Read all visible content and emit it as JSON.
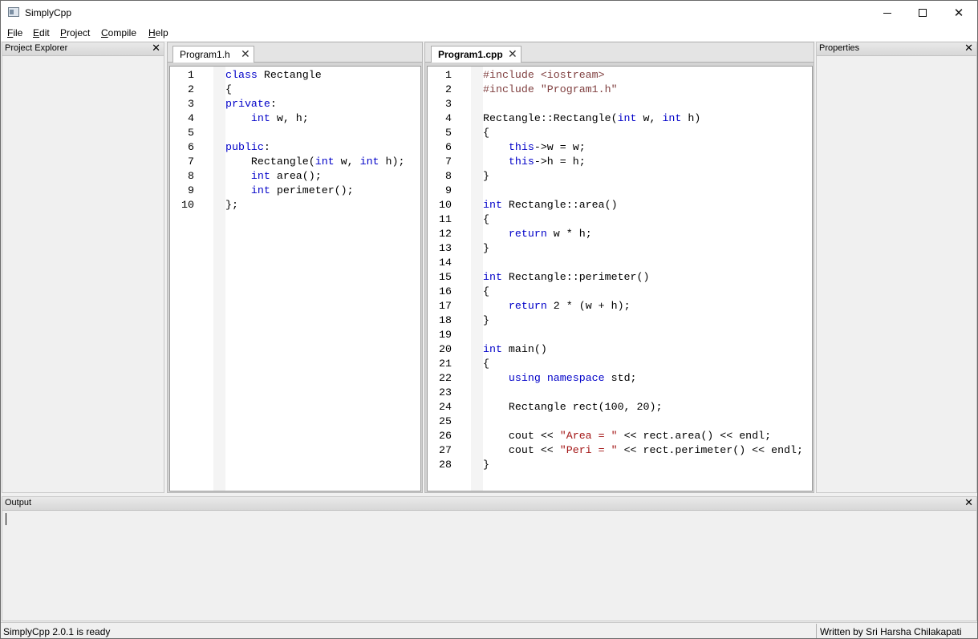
{
  "window": {
    "title": "SimplyCpp",
    "minimize_glyph": "",
    "maximize_glyph": "",
    "close_glyph": "✕"
  },
  "menu": {
    "items": [
      {
        "mnemonic": "F",
        "rest": "ile"
      },
      {
        "mnemonic": "E",
        "rest": "dit"
      },
      {
        "mnemonic": "P",
        "rest": "roject"
      },
      {
        "mnemonic": "C",
        "rest": "ompile"
      },
      {
        "mnemonic": "H",
        "rest": "elp"
      }
    ]
  },
  "panels": {
    "project_explorer": {
      "title": "Project Explorer",
      "close": "✕"
    },
    "properties": {
      "title": "Properties",
      "close": "✕"
    },
    "output": {
      "title": "Output",
      "close": "✕"
    }
  },
  "editors": {
    "left": {
      "tab_label": "Program1.h",
      "tab_close": "✕",
      "lines": [
        [
          {
            "t": "keyword",
            "s": "class"
          },
          {
            "t": "plain",
            "s": " Rectangle"
          }
        ],
        [
          {
            "t": "plain",
            "s": "{"
          }
        ],
        [
          {
            "t": "keyword",
            "s": "private"
          },
          {
            "t": "plain",
            "s": ":"
          }
        ],
        [
          {
            "t": "plain",
            "s": "    "
          },
          {
            "t": "keyword",
            "s": "int"
          },
          {
            "t": "plain",
            "s": " w, h;"
          }
        ],
        [],
        [
          {
            "t": "keyword",
            "s": "public"
          },
          {
            "t": "plain",
            "s": ":"
          }
        ],
        [
          {
            "t": "plain",
            "s": "    Rectangle("
          },
          {
            "t": "keyword",
            "s": "int"
          },
          {
            "t": "plain",
            "s": " w, "
          },
          {
            "t": "keyword",
            "s": "int"
          },
          {
            "t": "plain",
            "s": " h);"
          }
        ],
        [
          {
            "t": "plain",
            "s": "    "
          },
          {
            "t": "keyword",
            "s": "int"
          },
          {
            "t": "plain",
            "s": " area();"
          }
        ],
        [
          {
            "t": "plain",
            "s": "    "
          },
          {
            "t": "keyword",
            "s": "int"
          },
          {
            "t": "plain",
            "s": " perimeter();"
          }
        ],
        [
          {
            "t": "plain",
            "s": "};"
          }
        ]
      ]
    },
    "right": {
      "tab_label": "Program1.cpp",
      "tab_close": "✕",
      "lines": [
        [
          {
            "t": "preproc",
            "s": "#include <iostream>"
          }
        ],
        [
          {
            "t": "preproc",
            "s": "#include \"Program1.h\""
          }
        ],
        [],
        [
          {
            "t": "plain",
            "s": "Rectangle::Rectangle("
          },
          {
            "t": "keyword",
            "s": "int"
          },
          {
            "t": "plain",
            "s": " w, "
          },
          {
            "t": "keyword",
            "s": "int"
          },
          {
            "t": "plain",
            "s": " h)"
          }
        ],
        [
          {
            "t": "plain",
            "s": "{"
          }
        ],
        [
          {
            "t": "plain",
            "s": "    "
          },
          {
            "t": "keyword",
            "s": "this"
          },
          {
            "t": "plain",
            "s": "->w = w;"
          }
        ],
        [
          {
            "t": "plain",
            "s": "    "
          },
          {
            "t": "keyword",
            "s": "this"
          },
          {
            "t": "plain",
            "s": "->h = h;"
          }
        ],
        [
          {
            "t": "plain",
            "s": "}"
          }
        ],
        [],
        [
          {
            "t": "keyword",
            "s": "int"
          },
          {
            "t": "plain",
            "s": " Rectangle::area()"
          }
        ],
        [
          {
            "t": "plain",
            "s": "{"
          }
        ],
        [
          {
            "t": "plain",
            "s": "    "
          },
          {
            "t": "keyword",
            "s": "return"
          },
          {
            "t": "plain",
            "s": " w * h;"
          }
        ],
        [
          {
            "t": "plain",
            "s": "}"
          }
        ],
        [],
        [
          {
            "t": "keyword",
            "s": "int"
          },
          {
            "t": "plain",
            "s": " Rectangle::perimeter()"
          }
        ],
        [
          {
            "t": "plain",
            "s": "{"
          }
        ],
        [
          {
            "t": "plain",
            "s": "    "
          },
          {
            "t": "keyword",
            "s": "return"
          },
          {
            "t": "plain",
            "s": " 2 * (w + h);"
          }
        ],
        [
          {
            "t": "plain",
            "s": "}"
          }
        ],
        [],
        [
          {
            "t": "keyword",
            "s": "int"
          },
          {
            "t": "plain",
            "s": " main()"
          }
        ],
        [
          {
            "t": "plain",
            "s": "{"
          }
        ],
        [
          {
            "t": "plain",
            "s": "    "
          },
          {
            "t": "keyword",
            "s": "using"
          },
          {
            "t": "plain",
            "s": " "
          },
          {
            "t": "keyword",
            "s": "namespace"
          },
          {
            "t": "plain",
            "s": " std;"
          }
        ],
        [],
        [
          {
            "t": "plain",
            "s": "    Rectangle rect(100, 20);"
          }
        ],
        [],
        [
          {
            "t": "plain",
            "s": "    cout << "
          },
          {
            "t": "string",
            "s": "\"Area = \""
          },
          {
            "t": "plain",
            "s": " << rect.area() << endl;"
          }
        ],
        [
          {
            "t": "plain",
            "s": "    cout << "
          },
          {
            "t": "string",
            "s": "\"Peri = \""
          },
          {
            "t": "plain",
            "s": " << rect.perimeter() << endl;"
          }
        ],
        [
          {
            "t": "plain",
            "s": "}"
          }
        ]
      ]
    }
  },
  "status": {
    "left": "SimplyCpp 2.0.1 is ready",
    "right": "Written by Sri Harsha Chilakapati"
  },
  "colors": {
    "keyword": "#0000c8",
    "preproc": "#804040",
    "string": "#a31515"
  }
}
